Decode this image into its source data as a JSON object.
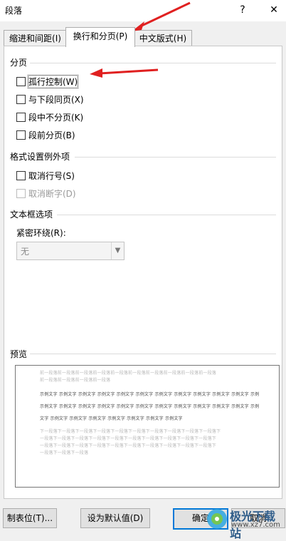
{
  "window": {
    "title": "段落",
    "help": "?",
    "close": "✕"
  },
  "tabs": [
    {
      "label": "缩进和间距(I)"
    },
    {
      "label": "换行和分页(P)"
    },
    {
      "label": "中文版式(H)"
    }
  ],
  "pagination": {
    "heading": "分页",
    "options": [
      {
        "label": "孤行控制(W)",
        "checked": false
      },
      {
        "label": "与下段同页(X)",
        "checked": false
      },
      {
        "label": "段中不分页(K)",
        "checked": false
      },
      {
        "label": "段前分页(B)",
        "checked": false
      }
    ]
  },
  "exceptions": {
    "heading": "格式设置例外项",
    "options": [
      {
        "label": "取消行号(S)",
        "checked": false,
        "disabled": false
      },
      {
        "label": "取消断字(D)",
        "checked": false,
        "disabled": true
      }
    ]
  },
  "textbox": {
    "heading": "文本框选项",
    "wrap_label": "紧密环绕(R):",
    "wrap_value": "无"
  },
  "preview": {
    "heading": "预览",
    "prev_lines": [
      "前一段落前一段落前一段落前一段落前一段落前一段落前一段落前一段落前一段落前一段落",
      "前一段落前一段落前一段落前一段落"
    ],
    "sample_lines": [
      "示例文字 示例文字 示例文字 示例文字 示例文字 示例文字 示例文字 示例文字 示例文字 示例文字 示例文字 示例",
      "示例文字 示例文字 示例文字 示例文字 示例文字 示例文字 示例文字 示例文字 示例文字 示例文字 示例文字 示例",
      "文字 示例文字 示例文字 示例文字 示例文字 示例文字 示例文字 示例文字"
    ],
    "next_lines": [
      "下一段落下一段落下一段落下一段落下一段落下一段落下一段落下一段落下一段落下一段落下",
      "一段落下一段落下一段落下一段落下一段落下一段落下一段落下一段落下一段落下一段落下",
      "一段落下一段落下一段落下一段落下一段落下一段落下一段落下一段落下一段落下一段落下",
      "一段落下一段落下一段落"
    ]
  },
  "buttons": {
    "tabs": "制表位(T)...",
    "set_default": "设为默认值(D)",
    "ok": "确定",
    "cancel": "取消"
  },
  "watermark": {
    "name": "极光下载站",
    "url": "www.xz7.com"
  },
  "colors": {
    "annotation_arrow": "#e02020",
    "focus_border": "#0078d7"
  }
}
